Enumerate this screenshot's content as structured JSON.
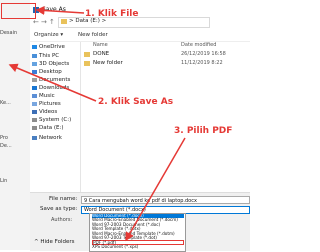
{
  "dialog": {
    "title": "Save As"
  },
  "background_fragments": [
    "Desain",
    "Ke...",
    "Pro",
    "De...",
    "Lin"
  ],
  "address": {
    "path": "> Data (E:) >"
  },
  "toolbar": {
    "organize": "Organize ▾",
    "new_folder": "New folder"
  },
  "nav_pane": {
    "items": [
      "OneDrive",
      "This PC",
      "3D Objects",
      "Desktop",
      "Documents",
      "Downloads",
      "Music",
      "Pictures",
      "Videos",
      "System (C:)",
      "Data (E:)",
      "Network"
    ]
  },
  "file_list": {
    "column_name": "Name",
    "column_date": "Date modified",
    "files": [
      {
        "name": "DONE",
        "date": "26/12/2019 16:58"
      },
      {
        "name": "New folder",
        "date": "11/12/2019 8:22"
      }
    ]
  },
  "form": {
    "file_name_label": "File name:",
    "file_name_value": "9 Cara mengubah word ke pdf di laptop.docx",
    "save_as_type_label": "Save as type:",
    "save_as_type_value": "Word Document (*.docx)",
    "authors_label": "Authors:",
    "hide_folders": "^ Hide Folders"
  },
  "save_type_options": [
    "Word Document (*.docx)",
    "Word Macro-Enabled Document (*.docm)",
    "Word 97-2003 Document (*.doc)",
    "Word Template (*.dotx)",
    "Word Macro-Enabled Template (*.dotm)",
    "Word 97-2003 Template (*.dot)",
    "PDF (*.pdf)",
    "XPS Document (*.xps)",
    "Single File Web Page (*.mht;*.mhtml)",
    "Web Page (*.htm;*.html)",
    "Web Page, Filtered (*.htm;*.html)"
  ],
  "selected_option_index": 0,
  "pdf_option_index": 6,
  "annotations": {
    "step1": "1. Klik File",
    "step2": "2. Klik Save As",
    "step3": "3. Pilih PDF"
  },
  "colors": {
    "accent": "#e53935",
    "selection": "#0078d7",
    "folder": "#e9c25b"
  }
}
